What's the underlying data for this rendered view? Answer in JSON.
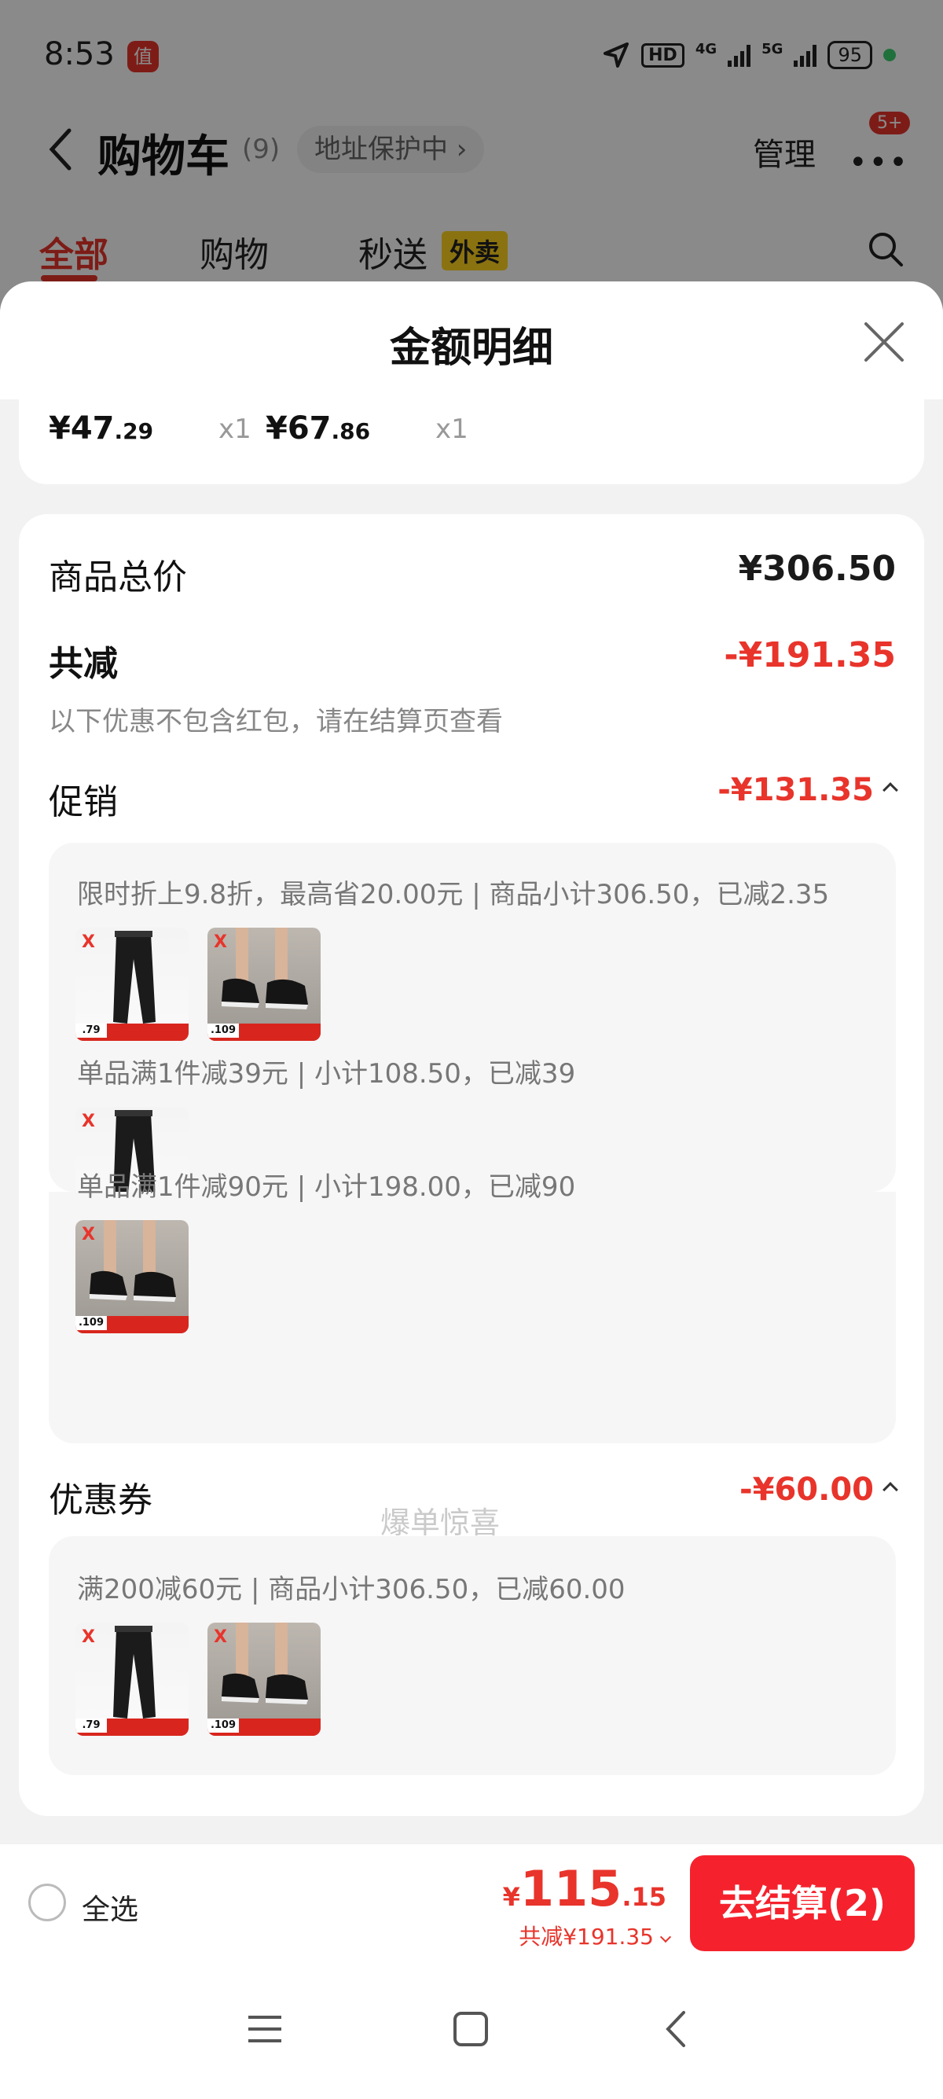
{
  "status_bar": {
    "time": "8:53",
    "app_badge": "值",
    "hd": "HD",
    "net1": "4G",
    "net2": "5G",
    "battery": "95"
  },
  "header": {
    "title": "购物车",
    "count": "(9)",
    "address": "地址保护中 ›",
    "manage": "管理",
    "more": "•••",
    "badge": "5+"
  },
  "tabs": [
    {
      "label": "全部"
    },
    {
      "label": "购物"
    },
    {
      "label": "秒送"
    }
  ],
  "tab_tag": "外卖",
  "sheet": {
    "title": "金额明细",
    "items": [
      {
        "price_int": "¥47",
        "price_dec": ".29",
        "qty": "x1"
      },
      {
        "price_int": "¥67",
        "price_dec": ".86",
        "qty": "x1"
      }
    ],
    "total_label": "商品总价",
    "total_value": "¥306.50",
    "discount_label": "共减",
    "discount_value": "-¥191.35",
    "discount_note": "以下优惠不包含红包，请在结算页查看",
    "promo": {
      "label": "促销",
      "value": "-¥131.35",
      "rules": [
        "限时折上9.8折，最高省20.00元 | 商品小计306.50，已减2.35",
        "单品满1件减39元 | 小计108.50，已减39",
        "单品满1件减90元 | 小计198.00，已减90"
      ],
      "watermark": "爆单惊喜"
    },
    "coupon": {
      "label": "优惠券",
      "value": "-¥60.00",
      "rule": "满200减60元 | 商品小计306.50，已减60.00"
    },
    "thumb_logo": "X",
    "thumb_pants_price": ".79",
    "thumb_shoes_price": ".109"
  },
  "bottom": {
    "select_all": "全选",
    "currency": "¥",
    "total_int": "115",
    "total_dec": ".15",
    "saved": "共减¥191.35",
    "checkout": "去结算(2)"
  },
  "colors": {
    "accent": "#f5222d",
    "discount": "#e8342b",
    "tag_yellow": "#ffd21e"
  }
}
